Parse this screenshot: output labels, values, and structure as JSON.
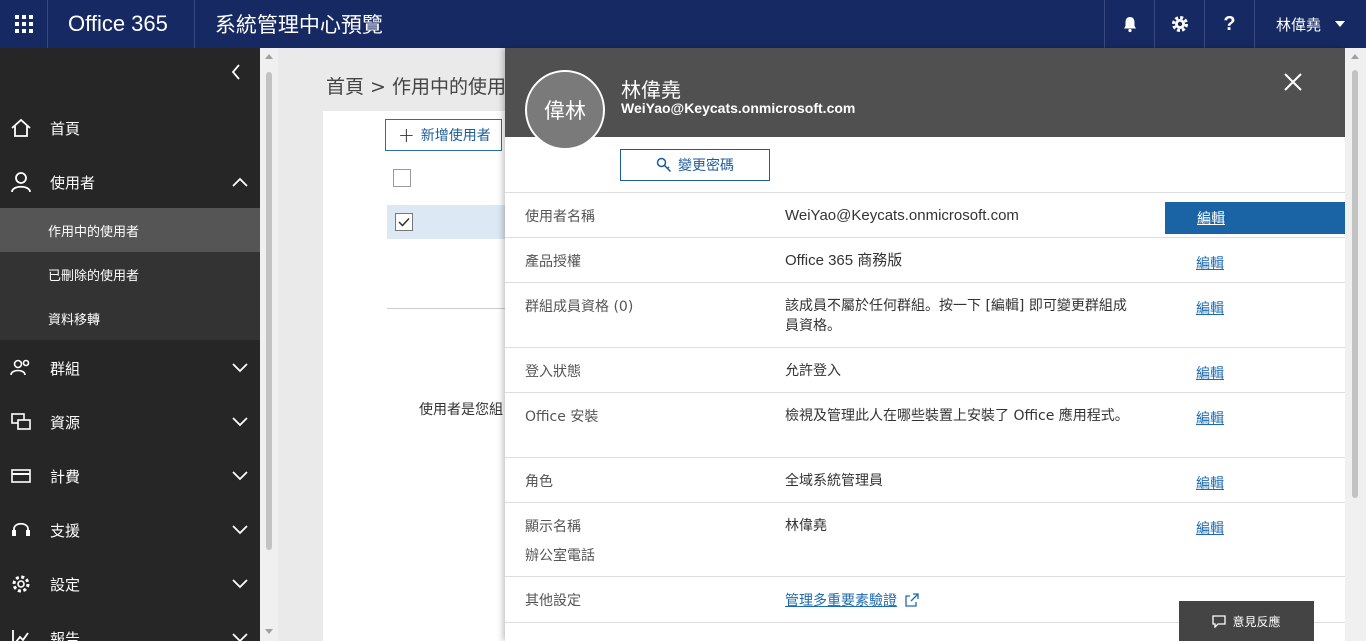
{
  "topbar": {
    "brand": "Office 365",
    "app_title": "系統管理中心預覽",
    "user_name": "林偉堯",
    "icons": [
      "waffle-icon",
      "bell-icon",
      "gear-icon",
      "help-icon"
    ]
  },
  "sidebar": {
    "items": [
      {
        "label": "首頁",
        "icon": "home-icon"
      },
      {
        "label": "使用者",
        "icon": "user-icon"
      },
      {
        "label": "群組",
        "icon": "group-icon"
      },
      {
        "label": "資源",
        "icon": "resources-icon"
      },
      {
        "label": "計費",
        "icon": "billing-icon"
      },
      {
        "label": "支援",
        "icon": "support-icon"
      },
      {
        "label": "設定",
        "icon": "settings-icon"
      },
      {
        "label": "報告",
        "icon": "reports-icon"
      }
    ],
    "subitems": [
      {
        "label": "作用中的使用者",
        "active": true
      },
      {
        "label": "已刪除的使用者"
      },
      {
        "label": "資料移轉"
      }
    ]
  },
  "main": {
    "breadcrumb": "首頁 > 作用中的使用",
    "add_user_label": "新增使用者",
    "desc_fragment": "使用者是您組"
  },
  "panel": {
    "avatar_initials": "偉林",
    "name": "林偉堯",
    "email": "WeiYao@Keycats.onmicrosoft.com",
    "change_password_label": "變更密碼",
    "edit_label": "編輯",
    "rows": [
      {
        "label": "使用者名稱",
        "value": "WeiYao@Keycats.onmicrosoft.com"
      },
      {
        "label": "產品授權",
        "value": "Office 365 商務版"
      },
      {
        "label": "群組成員資格 (0)",
        "value": "該成員不屬於任何群組。按一下 [編輯] 即可變更群組成員資格。"
      },
      {
        "label": "登入狀態",
        "value": "允許登入"
      },
      {
        "label": "Office 安裝",
        "value": "檢視及管理此人在哪些裝置上安裝了 Office 應用程式。"
      },
      {
        "label": "角色",
        "value": "全域系統管理員"
      },
      {
        "label": "顯示名稱",
        "label2": "辦公室電話",
        "value": "林偉堯"
      },
      {
        "label": "其他設定",
        "link": "管理多重要素驗證"
      }
    ]
  },
  "feedback_label": "意見反應",
  "colors": {
    "topbar": "#172963",
    "sidebar": "#262626",
    "accent": "#1a63a5",
    "panel_header": "#505050"
  }
}
